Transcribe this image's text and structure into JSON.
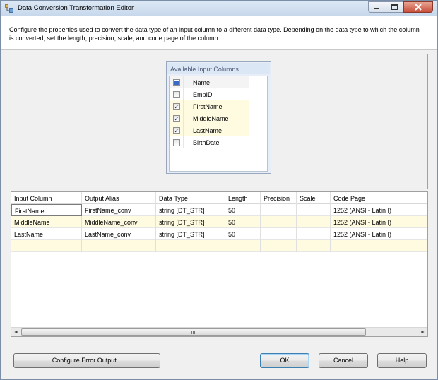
{
  "window": {
    "title": "Data Conversion Transformation Editor",
    "icon": "ssis-transform-icon"
  },
  "description": {
    "line1": "Configure the properties used to convert the data type of an input column to a different data type. Depending on the data type to which the column",
    "line2": "is converted, set the length, precision, scale, and code page of the column."
  },
  "available_columns": {
    "title": "Available Input Columns",
    "header": "Name",
    "items": [
      {
        "name": "EmpID",
        "checked": false
      },
      {
        "name": "FirstName",
        "checked": true
      },
      {
        "name": "MiddleName",
        "checked": true
      },
      {
        "name": "LastName",
        "checked": true
      },
      {
        "name": "BirthDate",
        "checked": false
      }
    ]
  },
  "grid": {
    "headers": [
      "Input Column",
      "Output Alias",
      "Data Type",
      "Length",
      "Precision",
      "Scale",
      "Code Page"
    ],
    "rows": [
      [
        "FirstName",
        "FirstName_conv",
        "string [DT_STR]",
        "50",
        "",
        "",
        "1252  (ANSI - Latin I)"
      ],
      [
        "MiddleName",
        "MiddleName_conv",
        "string [DT_STR]",
        "50",
        "",
        "",
        "1252  (ANSI - Latin I)"
      ],
      [
        "LastName",
        "LastName_conv",
        "string [DT_STR]",
        "50",
        "",
        "",
        "1252  (ANSI - Latin I)"
      ]
    ]
  },
  "buttons": {
    "configure_error": "Configure Error Output...",
    "ok": "OK",
    "cancel": "Cancel",
    "help": "Help"
  },
  "colors": {
    "selected_row": "#fffbe0",
    "check": "#223a6e"
  }
}
